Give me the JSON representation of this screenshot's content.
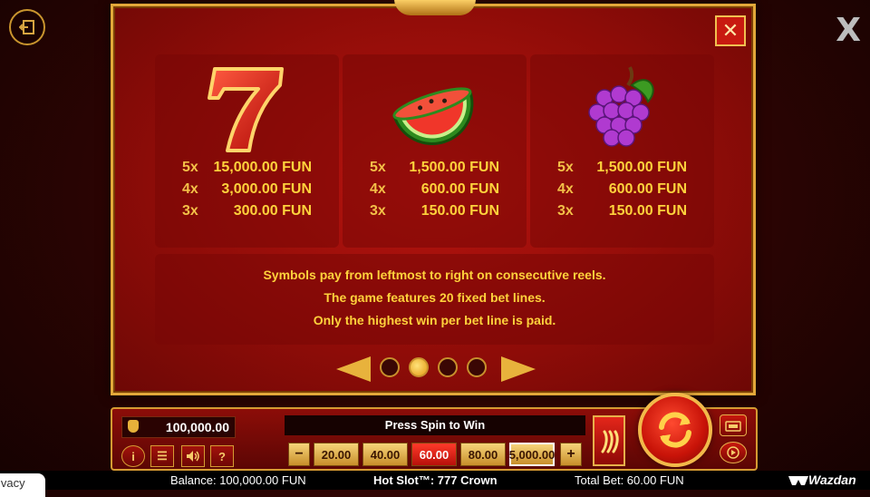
{
  "paytable": {
    "close_symbol": "✕",
    "symbols": [
      {
        "name": "seven-icon",
        "payouts": [
          {
            "mult": "5x",
            "amount": "15,000.00 FUN"
          },
          {
            "mult": "4x",
            "amount": "3,000.00 FUN"
          },
          {
            "mult": "3x",
            "amount": "300.00 FUN"
          }
        ]
      },
      {
        "name": "watermelon-icon",
        "payouts": [
          {
            "mult": "5x",
            "amount": "1,500.00 FUN"
          },
          {
            "mult": "4x",
            "amount": "600.00 FUN"
          },
          {
            "mult": "3x",
            "amount": "150.00 FUN"
          }
        ]
      },
      {
        "name": "grapes-icon",
        "payouts": [
          {
            "mult": "5x",
            "amount": "1,500.00 FUN"
          },
          {
            "mult": "4x",
            "amount": "600.00 FUN"
          },
          {
            "mult": "3x",
            "amount": "150.00 FUN"
          }
        ]
      }
    ],
    "info_lines": [
      "Symbols pay from leftmost to right on consecutive reels.",
      "The game features 20 fixed bet lines.",
      "Only the highest win per bet line is paid."
    ],
    "pages": 4,
    "active_page": 2
  },
  "controls": {
    "balance_display": "100,000.00",
    "message": "Press Spin to Win",
    "bet_values": [
      "20.00",
      "40.00",
      "60.00",
      "80.00",
      "5,000.00"
    ],
    "selected_bet": "60.00",
    "minus": "−",
    "plus": "+",
    "info_label": "i",
    "menu_label": "☰",
    "sound_label": "🔊",
    "help_label": "?",
    "turbo_label": "»"
  },
  "status_bar": {
    "balance": "Balance: 100,000.00 FUN",
    "game_title": "Hot Slot™: 777 Crown",
    "total_bet": "Total Bet: 60.00 FUN",
    "brand": "Wazdan",
    "privacy": "ivacy"
  },
  "colors": {
    "accent_gold": "#ffd23c",
    "panel_red": "#b8140f",
    "active_bet": "#ff3a2a"
  }
}
